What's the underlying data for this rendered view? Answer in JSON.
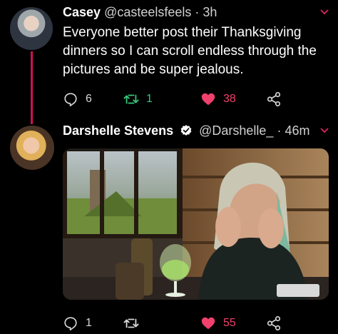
{
  "tweet1": {
    "name": "Casey",
    "handle": "@casteelsfeels",
    "separator": "·",
    "time": "3h",
    "text": "Everyone better post their Thanksgiving dinners so I can scroll endless through the pictures and be super jealous.",
    "replies": "6",
    "retweets": "1",
    "likes": "38"
  },
  "tweet2": {
    "name": "Darshelle Stevens",
    "handle": "@Darshelle_",
    "separator": "·",
    "time": "46m",
    "replies": "1",
    "retweets": "",
    "likes": "55"
  },
  "colors": {
    "background": "#000000",
    "thread_line": "#d20f5a",
    "like_active": "#f0416c",
    "retweet_active": "#33c97a",
    "verified": "#ffffff",
    "caret": "#e0245e"
  },
  "icons": [
    "reply-icon",
    "retweet-icon",
    "heart-icon",
    "share-icon",
    "verified-badge-icon",
    "chevron-down-icon"
  ]
}
